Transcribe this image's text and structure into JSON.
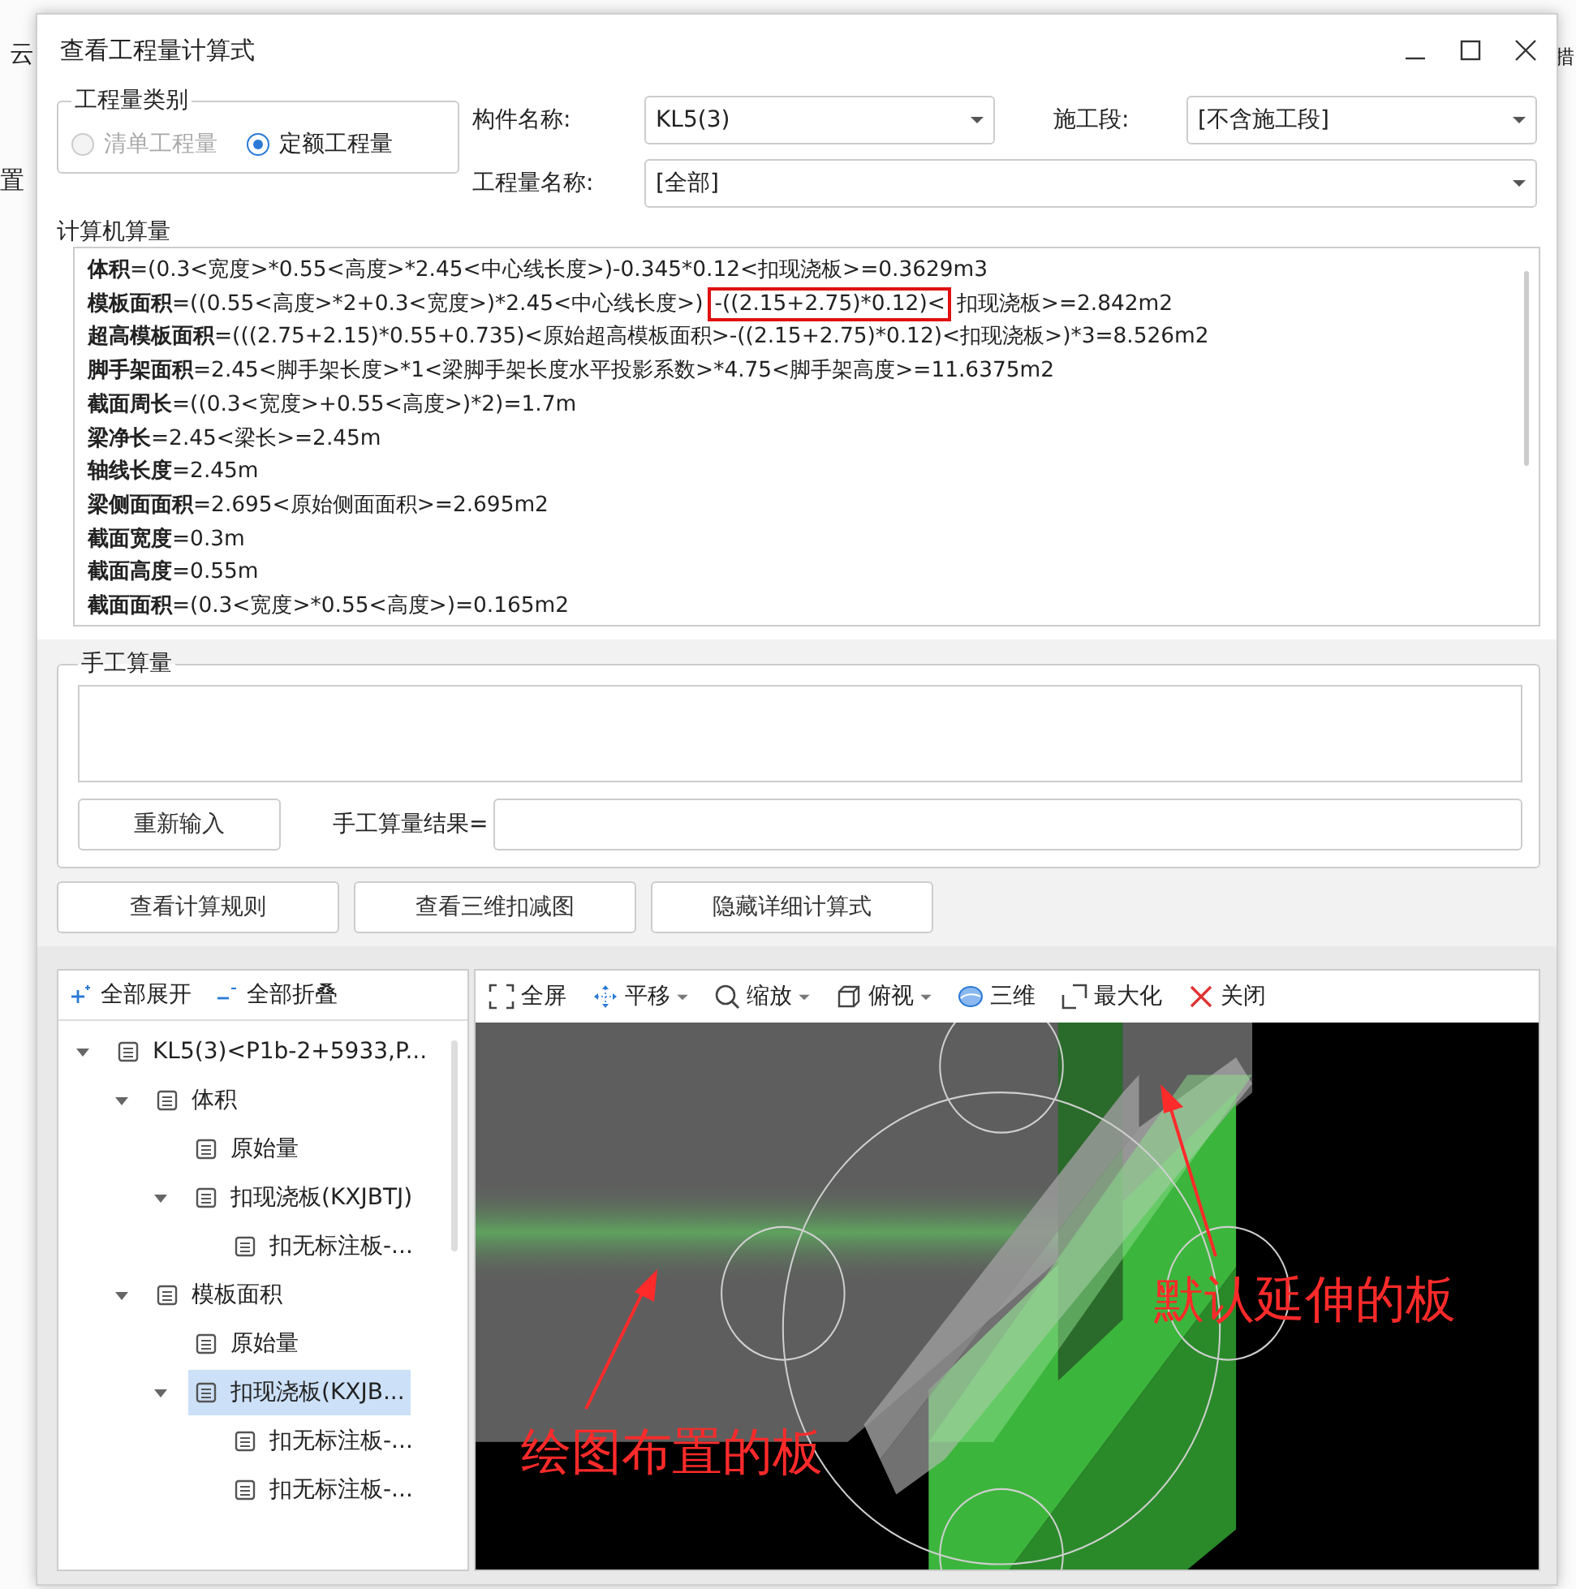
{
  "background_app": {
    "fragments": [
      "云",
      "置",
      "措"
    ]
  },
  "window": {
    "title": "查看工程量计算式"
  },
  "quantity_type": {
    "legend": "工程量类别",
    "options": [
      {
        "label": "清单工程量",
        "selected": false,
        "disabled": true
      },
      {
        "label": "定额工程量",
        "selected": true,
        "disabled": false
      }
    ]
  },
  "component_name": {
    "label": "构件名称:",
    "value": "KL5(3)"
  },
  "construction_stage": {
    "label": "施工段:",
    "value": "[不含施工段]"
  },
  "quantity_name": {
    "label": "工程量名称:",
    "value": "[全部]"
  },
  "computer_calc": {
    "legend": "计算机算量",
    "lines": [
      {
        "name": "体积",
        "expr": "=(0.3<宽度>*0.55<高度>*2.45<中心线长度>)-0.345*0.12<扣现浇板>=0.3629m3"
      },
      {
        "name": "模板面积",
        "expr": "=((0.55<高度>*2+0.3<宽度>)*2.45<中心线长度>)",
        "boxed": "-((2.15+2.75)*0.12)<",
        "expr_after": "扣现浇板>=2.842m2"
      },
      {
        "name": "超高模板面积",
        "expr": "=(((2.75+2.15)*0.55+0.735)<原始超高模板面积>-((2.15+2.75)*0.12)<扣现浇板>)*3=8.526m2"
      },
      {
        "name": "脚手架面积",
        "expr": "=2.45<脚手架长度>*1<梁脚手架长度水平投影系数>*4.75<脚手架高度>=11.6375m2"
      },
      {
        "name": "截面周长",
        "expr": "=((0.3<宽度>+0.55<高度>)*2)=1.7m"
      },
      {
        "name": "梁净长",
        "expr": "=2.45<梁长>=2.45m"
      },
      {
        "name": "轴线长度",
        "expr": "=2.45m"
      },
      {
        "name": "梁侧面面积",
        "expr": "=2.695<原始侧面面积>=2.695m2"
      },
      {
        "name": "截面宽度",
        "expr": "=0.3m"
      },
      {
        "name": "截面高度",
        "expr": "=0.55m"
      },
      {
        "name": "截面面积",
        "expr": "=(0.3<宽度>*0.55<高度>)=0.165m2"
      }
    ]
  },
  "manual_calc": {
    "legend": "手工算量",
    "reenter_button": "重新输入",
    "result_label": "手工算量结果="
  },
  "buttons": [
    "查看计算规则",
    "查看三维扣减图",
    "隐藏详细计算式"
  ],
  "tree_toolbar": [
    "全部展开",
    "全部折叠"
  ],
  "tree": [
    {
      "label": "KL5(3)<P1b-2+5933,P...",
      "expanded": true,
      "selected": false,
      "children": [
        {
          "label": "体积",
          "expanded": true,
          "selected": false,
          "children": [
            {
              "label": "原始量",
              "selected": false
            },
            {
              "label": "扣现浇板(KXJBTJ)",
              "expanded": true,
              "selected": false,
              "children": [
                {
                  "label": "扣无标注板-...",
                  "selected": false
                }
              ]
            }
          ]
        },
        {
          "label": "模板面积",
          "expanded": true,
          "selected": false,
          "children": [
            {
              "label": "原始量",
              "selected": false
            },
            {
              "label": "扣现浇板(KXJB...",
              "expanded": true,
              "selected": true,
              "children": [
                {
                  "label": "扣无标注板-...",
                  "selected": false
                },
                {
                  "label": "扣无标注板-...",
                  "selected": false
                }
              ]
            }
          ]
        }
      ]
    }
  ],
  "view_toolbar": [
    {
      "kind": "fullscreen",
      "label": "全屏",
      "dropdown": false
    },
    {
      "kind": "pan",
      "label": "平移",
      "dropdown": true
    },
    {
      "kind": "zoom",
      "label": "缩放",
      "dropdown": true
    },
    {
      "kind": "topview",
      "label": "俯视",
      "dropdown": true
    },
    {
      "kind": "threed",
      "label": "三维",
      "dropdown": false
    },
    {
      "kind": "maximize",
      "label": "最大化",
      "dropdown": false
    },
    {
      "kind": "close",
      "label": "关闭",
      "dropdown": false
    }
  ],
  "annotations": [
    "默认延伸的板",
    "绘图布置的板"
  ]
}
